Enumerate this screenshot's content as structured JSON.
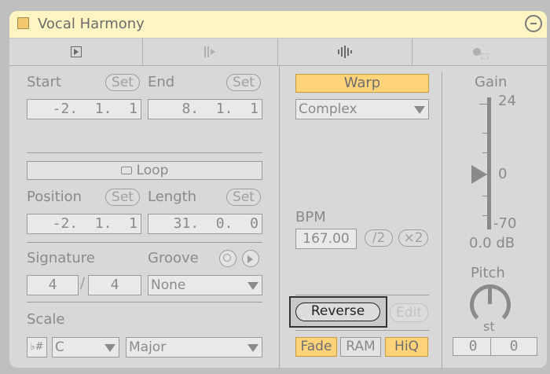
{
  "window": {
    "title": "Vocal Harmony"
  },
  "tabs": [
    {
      "icon": "play-clip-icon"
    },
    {
      "icon": "launch-icon"
    },
    {
      "icon": "sample-waveform-icon"
    },
    {
      "icon": "envelopes-icon"
    }
  ],
  "left": {
    "start_label": "Start",
    "end_label": "End",
    "set_label": "Set",
    "start_value": "-2.  1.  1",
    "end_value": "8.  1.  1",
    "loop_label": "Loop",
    "position_label": "Position",
    "length_label": "Length",
    "position_value": "-2.  1.  1",
    "length_value": "31.  0.  0",
    "signature_label": "Signature",
    "groove_label": "Groove",
    "sig_num": "4",
    "sig_den": "4",
    "sig_sep": "/",
    "groove_value": "None",
    "scale_label": "Scale",
    "scale_toggle": "♭#",
    "scale_root": "C",
    "scale_mode": "Major"
  },
  "middle": {
    "warp_label": "Warp",
    "warp_mode": "Complex",
    "bpm_label": "BPM",
    "bpm_value": "167.00",
    "half_label": "/2",
    "double_label": "×2",
    "reverse_label": "Reverse",
    "edit_label": "Edit",
    "fade_label": "Fade",
    "ram_label": "RAM",
    "hiq_label": "HiQ"
  },
  "right": {
    "gain_label": "Gain",
    "gain_top": "24",
    "gain_mid": "0",
    "gain_bottom": "-70",
    "gain_value": "0.0 dB",
    "pitch_label": "Pitch",
    "pitch_unit": "st",
    "pitch_semitones": "0",
    "pitch_cents": "0"
  },
  "colors": {
    "accent": "#ffd37a",
    "title_bar": "#fff5c2"
  }
}
